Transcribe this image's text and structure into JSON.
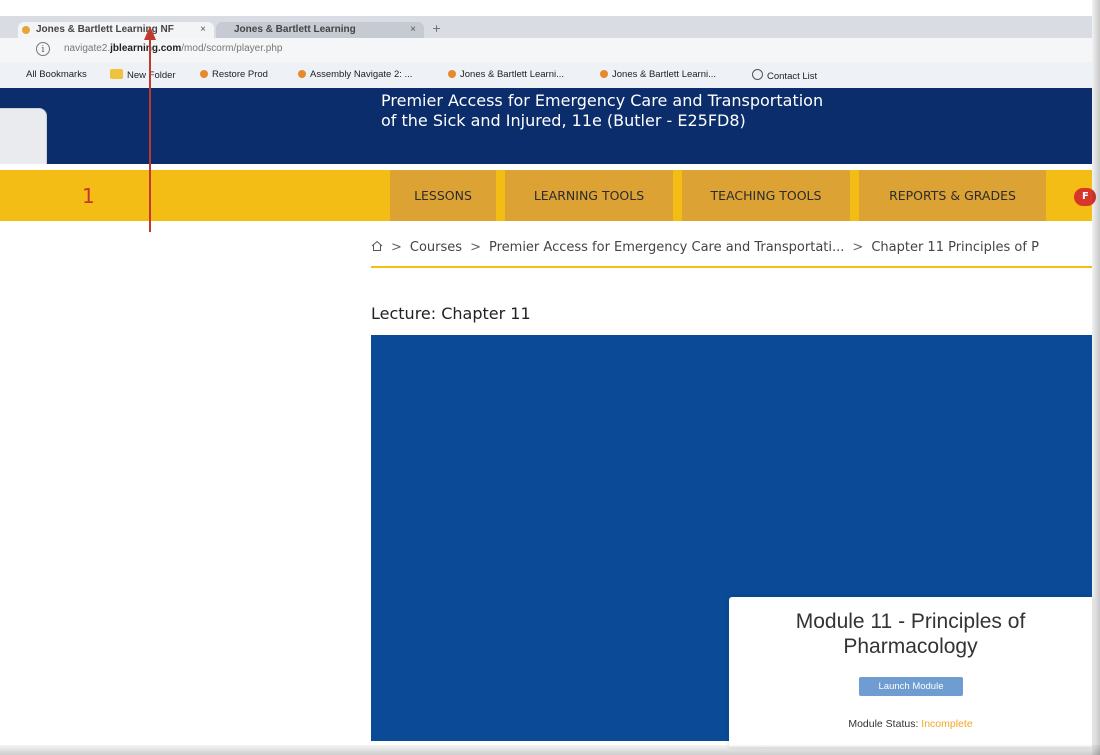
{
  "browser": {
    "tabs": [
      {
        "label": "Jones & Bartlett Learning NF",
        "close": "×"
      },
      {
        "label": "Jones & Bartlett Learning",
        "close": "×"
      }
    ],
    "new_tab": "+",
    "url_prefix": "navigate2.",
    "url_domain": "jblearning.com",
    "url_path": "/mod/scorm/player.php",
    "info_glyph": "i"
  },
  "bookmarks": [
    {
      "label": "All Bookmarks",
      "icon": "none"
    },
    {
      "label": "New Folder",
      "icon": "folder-icon"
    },
    {
      "label": "Restore Prod",
      "icon": "site-icon"
    },
    {
      "label": "Assembly Navigate 2: ...",
      "icon": "site-icon"
    },
    {
      "label": "Jones & Bartlett Learni...",
      "icon": "site-icon"
    },
    {
      "label": "Jones & Bartlett Learni...",
      "icon": "site-icon"
    },
    {
      "label": "Contact List",
      "icon": "globe-icon"
    }
  ],
  "header": {
    "title_line1": "Premier Access for Emergency Care and Transportation",
    "title_line2": "of the Sick and Injured, 11e (Butler - E25FD8)"
  },
  "annotation": {
    "number": "1"
  },
  "nav": {
    "items": [
      "LESSONS",
      "LEARNING TOOLS",
      "TEACHING TOOLS",
      "REPORTS & GRADES"
    ],
    "badge": "F"
  },
  "breadcrumb": {
    "items": [
      "Courses",
      "Premier Access for Emergency Care and Transportati...",
      "Chapter 11 Principles of P"
    ],
    "separator": ">"
  },
  "lecture": {
    "title": "Lecture: Chapter 11"
  },
  "module": {
    "title_line1": "Module 11 - Principles of",
    "title_line2": "Pharmacology",
    "launch_label": "Launch Module",
    "status_label": "Module Status: ",
    "status_value": "Incomplete"
  },
  "colors": {
    "header_bg": "#0c2d6b",
    "nav_bg": "#f4bd16",
    "nav_item_bg": "#dca233",
    "content_bg": "#0a4a96",
    "status_incomplete": "#f5a623",
    "annotation": "#c0392b"
  }
}
